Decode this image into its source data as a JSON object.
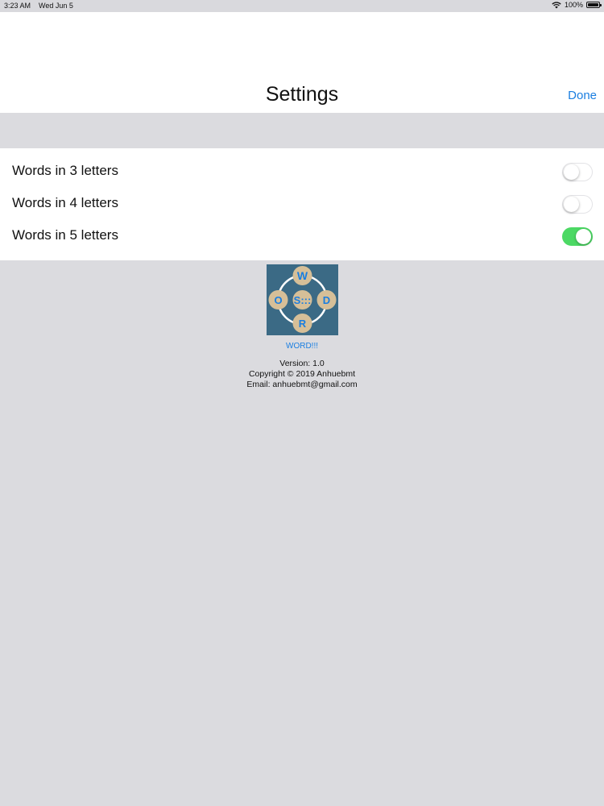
{
  "status": {
    "time": "3:23 AM",
    "date": "Wed Jun 5",
    "battery": "100%",
    "wifi_icon": "wifi-icon",
    "battery_icon": "battery-icon"
  },
  "navbar": {
    "title": "Settings",
    "done_label": "Done"
  },
  "settings": [
    {
      "label": "Words in 3 letters",
      "on": false
    },
    {
      "label": "Words in 4 letters",
      "on": false
    },
    {
      "label": "Words in 5 letters",
      "on": true
    }
  ],
  "about": {
    "logo_letters": [
      "W",
      "O",
      "S:::",
      "D",
      "R"
    ],
    "app_name": "WORD!!!",
    "version": "Version: 1.0",
    "copyright": "Copyright © 2019 Anhuebmt",
    "email": "Email: anhuebmt@gmail.com"
  },
  "colors": {
    "accent": "#1a7ee0",
    "toggle_on": "#4cd964",
    "logo_bg": "#3b6a85",
    "logo_tile": "#d6bf98"
  }
}
